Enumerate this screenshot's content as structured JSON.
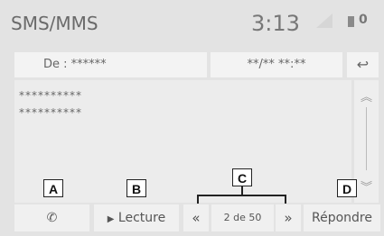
{
  "header": {
    "title": "SMS/MMS",
    "clock": "3:13",
    "status_zero": "0"
  },
  "message": {
    "from_label": "De : ******",
    "date": "**/** **:**",
    "lines": [
      "**********",
      "**********"
    ]
  },
  "buttons": {
    "play_label": "Lecture",
    "prev_label": "«",
    "next_label": "»",
    "page_indicator": "2 de 50",
    "reply_label": "Répondre"
  },
  "callouts": {
    "a": "A",
    "b": "B",
    "c": "C",
    "d": "D"
  }
}
